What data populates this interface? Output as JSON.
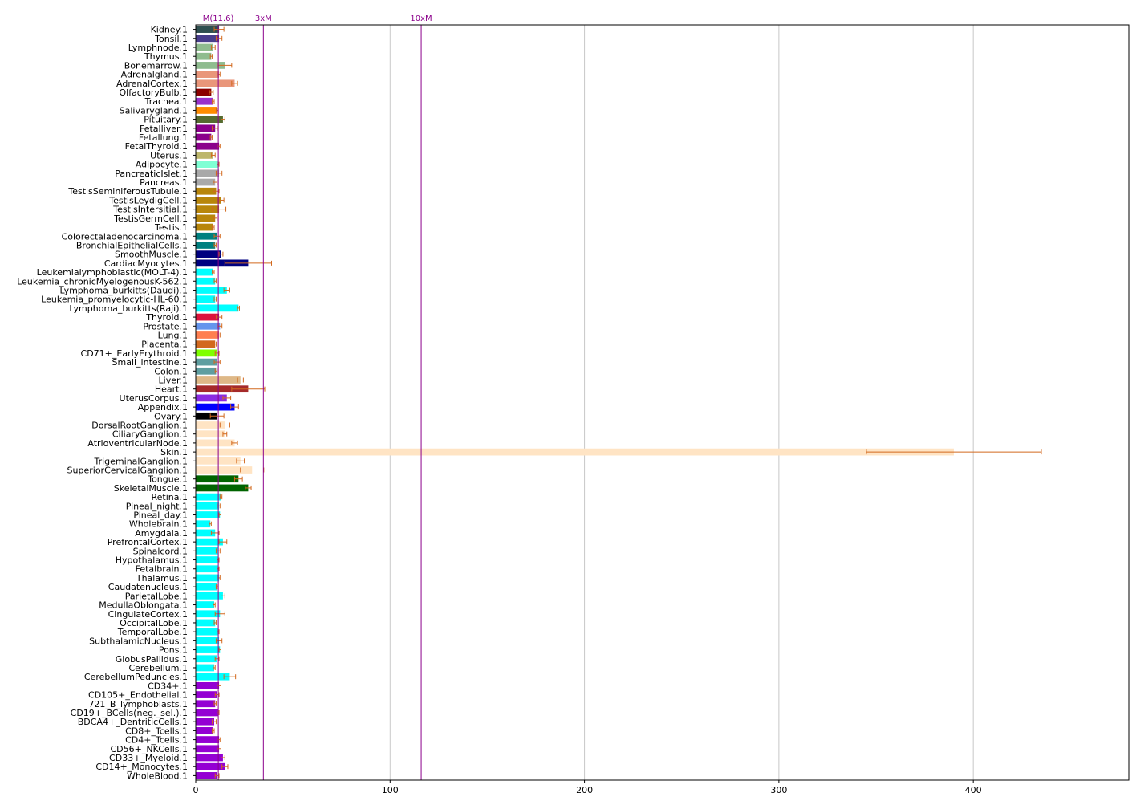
{
  "chart_data": {
    "type": "bar",
    "orientation": "horizontal",
    "xlim": [
      0,
      480
    ],
    "x_ticks": [
      0,
      100,
      200,
      300,
      400
    ],
    "grid": "vertical",
    "reference_lines": [
      {
        "label": "M(11.6)",
        "value": 11.6,
        "color": "#8b008b"
      },
      {
        "label": "3xM",
        "value": 34.8,
        "color": "#8b008b"
      },
      {
        "label": "10xM",
        "value": 116,
        "color": "#8b008b"
      }
    ],
    "error_color": "#d2691e",
    "bars": [
      {
        "label": "Kidney.1",
        "value": 12,
        "err": 2.5,
        "color": "#2f4f4f"
      },
      {
        "label": "Tonsil.1",
        "value": 12,
        "err": 1.5,
        "color": "#483d8b"
      },
      {
        "label": "Lymphnode.1",
        "value": 9,
        "err": 1,
        "color": "#8fbc8f"
      },
      {
        "label": "Thymus.1",
        "value": 8,
        "err": 0.5,
        "color": "#8fbc8f"
      },
      {
        "label": "Bonemarrow.1",
        "value": 15,
        "err": 3.5,
        "color": "#8fbc8f"
      },
      {
        "label": "Adrenalgland.1",
        "value": 12,
        "err": 0.5,
        "color": "#e9967a"
      },
      {
        "label": "AdrenalCortex.1",
        "value": 20,
        "err": 1.5,
        "color": "#e9967a"
      },
      {
        "label": "OlfactoryBulb.1",
        "value": 8,
        "err": 1,
        "color": "#8b0000"
      },
      {
        "label": "Trachea.1",
        "value": 9,
        "err": 0.5,
        "color": "#9932cc"
      },
      {
        "label": "Salivarygland.1",
        "value": 11,
        "err": 0.5,
        "color": "#ff8c00"
      },
      {
        "label": "Pituitary.1",
        "value": 14,
        "err": 1,
        "color": "#556b2f"
      },
      {
        "label": "Fetalliver.1",
        "value": 10,
        "err": 1.5,
        "color": "#8b008b"
      },
      {
        "label": "Fetallung.1",
        "value": 8,
        "err": 0.5,
        "color": "#8b008b"
      },
      {
        "label": "FetalThyroid.1",
        "value": 12,
        "err": 0.5,
        "color": "#8b008b"
      },
      {
        "label": "Uterus.1",
        "value": 9,
        "err": 1,
        "color": "#bdb76b"
      },
      {
        "label": "Adipocyte.1",
        "value": 11.5,
        "err": 0.5,
        "color": "#7fffd4"
      },
      {
        "label": "PancreaticIslet.1",
        "value": 12,
        "err": 1.5,
        "color": "#a9a9a9"
      },
      {
        "label": "Pancreas.1",
        "value": 10,
        "err": 1,
        "color": "#a9a9a9"
      },
      {
        "label": "TestisSeminiferousTubule.1",
        "value": 10.5,
        "err": 1.5,
        "color": "#b8860b"
      },
      {
        "label": "TestisLeydigCell.1",
        "value": 13,
        "err": 1.5,
        "color": "#b8860b"
      },
      {
        "label": "TestisIntersitial.1",
        "value": 12,
        "err": 3.5,
        "color": "#b8860b"
      },
      {
        "label": "TestisGermCell.1",
        "value": 10,
        "err": 1,
        "color": "#b8860b"
      },
      {
        "label": "Testis.1",
        "value": 9,
        "err": 0.5,
        "color": "#b8860b"
      },
      {
        "label": "Colorectaladenocarcinoma.1",
        "value": 11,
        "err": 1.5,
        "color": "#008080"
      },
      {
        "label": "BronchialEpithelialCells.1",
        "value": 10,
        "err": 0.5,
        "color": "#008080"
      },
      {
        "label": "SmoothMuscle.1",
        "value": 13,
        "err": 1,
        "color": "#000080"
      },
      {
        "label": "CardiacMyocytes.1",
        "value": 27,
        "err": 12,
        "color": "#000080"
      },
      {
        "label": "Leukemialymphoblastic(MOLT-4).1",
        "value": 9,
        "err": 0.5,
        "color": "#00ffff"
      },
      {
        "label": "Leukemia_chronicMyelogenousK-562.1",
        "value": 10,
        "err": 0.5,
        "color": "#00ffff"
      },
      {
        "label": "Lymphoma_burkitts(Daudi).1",
        "value": 16,
        "err": 1.5,
        "color": "#00ffff"
      },
      {
        "label": "Leukemia_promyelocytic-HL-60.1",
        "value": 10,
        "err": 0.5,
        "color": "#00ffff"
      },
      {
        "label": "Lymphoma_burkitts(Raji).1",
        "value": 22,
        "err": 0.5,
        "color": "#00ffff"
      },
      {
        "label": "Thyroid.1",
        "value": 12,
        "err": 1.5,
        "color": "#dc143c"
      },
      {
        "label": "Prostate.1",
        "value": 12.5,
        "err": 1,
        "color": "#6495ed"
      },
      {
        "label": "Lung.1",
        "value": 12,
        "err": 0.5,
        "color": "#ff7f50"
      },
      {
        "label": "Placenta.1",
        "value": 10,
        "err": 0.5,
        "color": "#d2691e"
      },
      {
        "label": "CD71+_EarlyErythroid.1",
        "value": 11,
        "err": 1,
        "color": "#7fff00"
      },
      {
        "label": "Small_intestine.1",
        "value": 11,
        "err": 1.5,
        "color": "#5f9ea0"
      },
      {
        "label": "Colon.1",
        "value": 10.5,
        "err": 0.5,
        "color": "#5f9ea0"
      },
      {
        "label": "Liver.1",
        "value": 23,
        "err": 1.5,
        "color": "#deb887"
      },
      {
        "label": "Heart.1",
        "value": 27,
        "err": 8.5,
        "color": "#a52a2a"
      },
      {
        "label": "UterusCorpus.1",
        "value": 16,
        "err": 2,
        "color": "#8a2be2"
      },
      {
        "label": "Appendix.1",
        "value": 20,
        "err": 2,
        "color": "#0000ff"
      },
      {
        "label": "Ovary.1",
        "value": 11,
        "err": 3.5,
        "color": "#000000"
      },
      {
        "label": "DorsalRootGanglion.1",
        "value": 15,
        "err": 2.5,
        "color": "#ffe4c4"
      },
      {
        "label": "CiliaryGanglion.1",
        "value": 15,
        "err": 1,
        "color": "#ffe4c4"
      },
      {
        "label": "AtrioventricularNode.1",
        "value": 20,
        "err": 1.5,
        "color": "#ffe4c4"
      },
      {
        "label": "Skin.1",
        "value": 390,
        "err": 45,
        "color": "#ffe4c4"
      },
      {
        "label": "TrigeminalGanglion.1",
        "value": 23,
        "err": 2,
        "color": "#ffe4c4"
      },
      {
        "label": "SuperiorCervicalGanglion.1",
        "value": 29,
        "err": 6,
        "color": "#ffe4c4"
      },
      {
        "label": "Tongue.1",
        "value": 22,
        "err": 2,
        "color": "#006400"
      },
      {
        "label": "SkeletalMuscle.1",
        "value": 27,
        "err": 1.5,
        "color": "#006400"
      },
      {
        "label": "Retina.1",
        "value": 13,
        "err": 0.5,
        "color": "#00ffff"
      },
      {
        "label": "Pineal_night.1",
        "value": 12,
        "err": 0.5,
        "color": "#00ffff"
      },
      {
        "label": "Pineal_day.1",
        "value": 12.5,
        "err": 0.5,
        "color": "#00ffff"
      },
      {
        "label": "Wholebrain.1",
        "value": 7.5,
        "err": 0.5,
        "color": "#00ffff"
      },
      {
        "label": "Amygdala.1",
        "value": 10,
        "err": 2,
        "color": "#00ffff"
      },
      {
        "label": "PrefrontalCortex.1",
        "value": 14,
        "err": 2,
        "color": "#00ffff"
      },
      {
        "label": "Spinalcord.1",
        "value": 11.5,
        "err": 1,
        "color": "#00ffff"
      },
      {
        "label": "Hypothalamus.1",
        "value": 11.5,
        "err": 0.5,
        "color": "#00ffff"
      },
      {
        "label": "Fetalbrain.1",
        "value": 11.5,
        "err": 0.5,
        "color": "#00ffff"
      },
      {
        "label": "Thalamus.1",
        "value": 12,
        "err": 0.5,
        "color": "#00ffff"
      },
      {
        "label": "Caudatenucleus.1",
        "value": 11,
        "err": 0.5,
        "color": "#00ffff"
      },
      {
        "label": "ParietalLobe.1",
        "value": 14,
        "err": 1,
        "color": "#00ffff"
      },
      {
        "label": "MedullaOblongata.1",
        "value": 9.5,
        "err": 0.5,
        "color": "#00ffff"
      },
      {
        "label": "CingulateCortex.1",
        "value": 12.5,
        "err": 2.5,
        "color": "#00ffff"
      },
      {
        "label": "OccipitalLobe.1",
        "value": 10,
        "err": 0.5,
        "color": "#00ffff"
      },
      {
        "label": "TemporalLobe.1",
        "value": 11.5,
        "err": 0.5,
        "color": "#00ffff"
      },
      {
        "label": "SubthalamicNucleus.1",
        "value": 12,
        "err": 1.5,
        "color": "#00ffff"
      },
      {
        "label": "Pons.1",
        "value": 12.5,
        "err": 0.5,
        "color": "#00ffff"
      },
      {
        "label": "GlobusPallidus.1",
        "value": 11,
        "err": 1,
        "color": "#00ffff"
      },
      {
        "label": "Cerebellum.1",
        "value": 9.5,
        "err": 0.5,
        "color": "#00ffff"
      },
      {
        "label": "CerebellumPeduncles.1",
        "value": 17.5,
        "err": 3,
        "color": "#00ffff"
      },
      {
        "label": "CD34+.1",
        "value": 12,
        "err": 1,
        "color": "#9400d3"
      },
      {
        "label": "CD105+_Endothelial.1",
        "value": 11,
        "err": 1,
        "color": "#9400d3"
      },
      {
        "label": "721_B_lymphoblasts.1",
        "value": 10,
        "err": 0.5,
        "color": "#9400d3"
      },
      {
        "label": "CD19+_BCells(neg._sel.).1",
        "value": 11.5,
        "err": 0.5,
        "color": "#9400d3"
      },
      {
        "label": "BDCA4+_DentriticCells.1",
        "value": 9.5,
        "err": 1,
        "color": "#9400d3"
      },
      {
        "label": "CD8+_Tcells.1",
        "value": 9,
        "err": 0.5,
        "color": "#9400d3"
      },
      {
        "label": "CD4+_Tcells.1",
        "value": 12,
        "err": 0.5,
        "color": "#9400d3"
      },
      {
        "label": "CD56+_NKCells.1",
        "value": 12,
        "err": 1,
        "color": "#9400d3"
      },
      {
        "label": "CD33+_Myeloid.1",
        "value": 14,
        "err": 1,
        "color": "#9400d3"
      },
      {
        "label": "CD14+_Monocytes.1",
        "value": 15,
        "err": 1.5,
        "color": "#9400d3"
      },
      {
        "label": "WholeBlood.1",
        "value": 11,
        "err": 1,
        "color": "#9400d3"
      }
    ]
  }
}
